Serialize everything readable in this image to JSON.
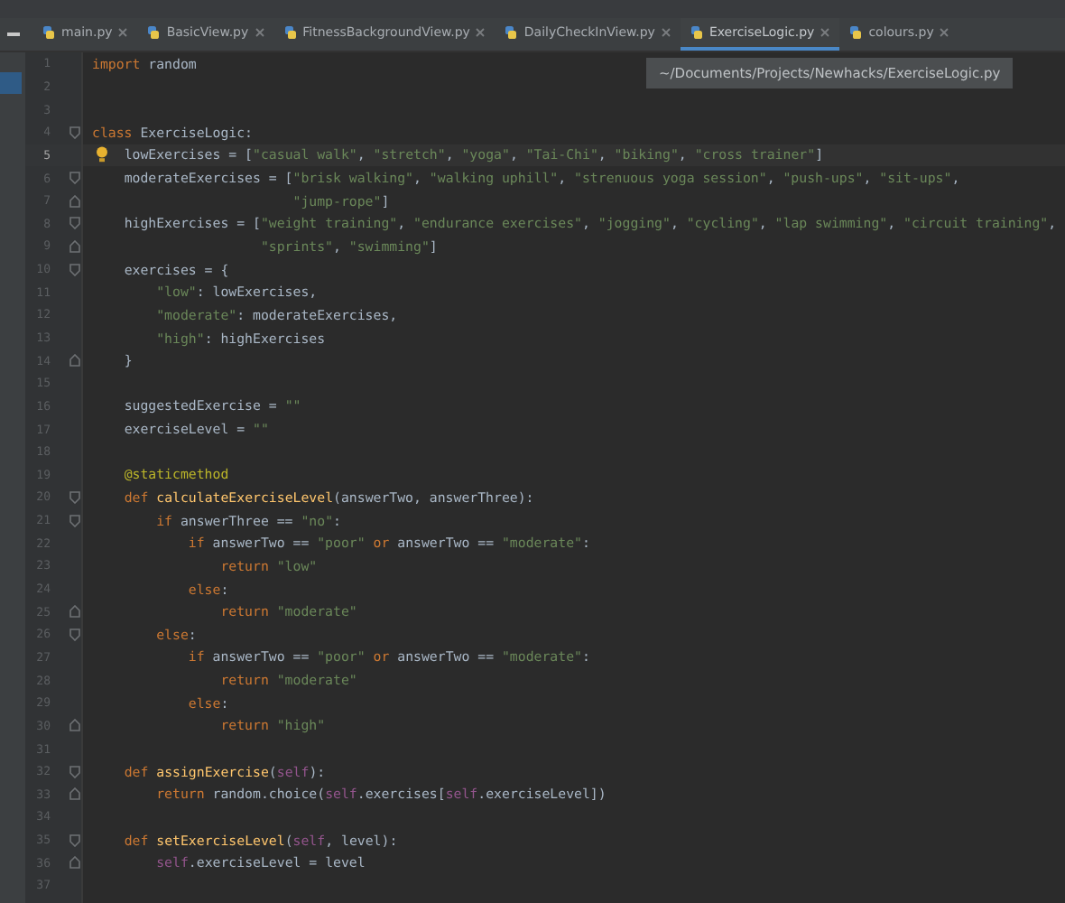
{
  "tabs": [
    {
      "label": "main.py",
      "selected": false
    },
    {
      "label": "BasicView.py",
      "selected": false
    },
    {
      "label": "FitnessBackgroundView.py",
      "selected": false
    },
    {
      "label": "DailyCheckInView.py",
      "selected": false
    },
    {
      "label": "ExerciseLogic.py",
      "selected": true
    },
    {
      "label": "colours.py",
      "selected": false
    }
  ],
  "tooltip": "~/Documents/Projects/Newhacks/ExerciseLogic.py",
  "lines": [
    {
      "number": "1",
      "current": false,
      "hint": false,
      "fold_start": false,
      "fold_end": false,
      "tokens": [
        {
          "kind": "kw",
          "text": "import"
        },
        {
          "kind": "plain",
          "text": " random"
        }
      ]
    },
    {
      "number": "2",
      "current": false,
      "hint": false,
      "fold_start": false,
      "fold_end": false
    },
    {
      "number": "3",
      "current": false,
      "hint": false,
      "fold_start": false,
      "fold_end": false
    },
    {
      "number": "4",
      "current": false,
      "hint": false,
      "fold_start": true,
      "fold_end": false,
      "tokens": [
        {
          "kind": "kw",
          "text": "class"
        },
        {
          "kind": "plain",
          "text": " ExerciseLogic:"
        }
      ]
    },
    {
      "number": "5",
      "current": true,
      "hint": true,
      "fold_start": false,
      "fold_end": false,
      "tokens": [
        {
          "kind": "plain",
          "text": "    lowExercises = ["
        },
        {
          "kind": "str",
          "text": "\"casual walk\""
        },
        {
          "kind": "plain",
          "text": ", "
        },
        {
          "kind": "str",
          "text": "\"stretch\""
        },
        {
          "kind": "plain",
          "text": ", "
        },
        {
          "kind": "str",
          "text": "\"yoga\""
        },
        {
          "kind": "plain",
          "text": ", "
        },
        {
          "kind": "str",
          "text": "\"Tai-Chi\""
        },
        {
          "kind": "plain",
          "text": ", "
        },
        {
          "kind": "str",
          "text": "\"biking\""
        },
        {
          "kind": "plain",
          "text": ", "
        },
        {
          "kind": "str",
          "text": "\"cross trainer\""
        },
        {
          "kind": "plain",
          "text": "]"
        }
      ]
    },
    {
      "number": "6",
      "current": false,
      "hint": false,
      "fold_start": true,
      "fold_end": false,
      "tokens": [
        {
          "kind": "plain",
          "text": "    moderateExercises = ["
        },
        {
          "kind": "str",
          "text": "\"brisk walking\""
        },
        {
          "kind": "plain",
          "text": ", "
        },
        {
          "kind": "str",
          "text": "\"walking uphill\""
        },
        {
          "kind": "plain",
          "text": ", "
        },
        {
          "kind": "str",
          "text": "\"strenuous yoga session\""
        },
        {
          "kind": "plain",
          "text": ", "
        },
        {
          "kind": "str",
          "text": "\"push-ups\""
        },
        {
          "kind": "plain",
          "text": ", "
        },
        {
          "kind": "str",
          "text": "\"sit-ups\""
        },
        {
          "kind": "plain",
          "text": ","
        }
      ]
    },
    {
      "number": "7",
      "current": false,
      "hint": false,
      "fold_start": false,
      "fold_end": true,
      "tokens": [
        {
          "kind": "str",
          "text": "                         \"jump-rope\""
        },
        {
          "kind": "plain",
          "text": "]"
        }
      ]
    },
    {
      "number": "8",
      "current": false,
      "hint": false,
      "fold_start": true,
      "fold_end": false,
      "tokens": [
        {
          "kind": "plain",
          "text": "    highExercises = ["
        },
        {
          "kind": "str",
          "text": "\"weight training\""
        },
        {
          "kind": "plain",
          "text": ", "
        },
        {
          "kind": "str",
          "text": "\"endurance exercises\""
        },
        {
          "kind": "plain",
          "text": ", "
        },
        {
          "kind": "str",
          "text": "\"jogging\""
        },
        {
          "kind": "plain",
          "text": ", "
        },
        {
          "kind": "str",
          "text": "\"cycling\""
        },
        {
          "kind": "plain",
          "text": ", "
        },
        {
          "kind": "str",
          "text": "\"lap swimming\""
        },
        {
          "kind": "plain",
          "text": ", "
        },
        {
          "kind": "str",
          "text": "\"circuit training\""
        },
        {
          "kind": "plain",
          "text": ","
        }
      ]
    },
    {
      "number": "9",
      "current": false,
      "hint": false,
      "fold_start": false,
      "fold_end": true,
      "tokens": [
        {
          "kind": "str",
          "text": "                     \"sprints\""
        },
        {
          "kind": "plain",
          "text": ", "
        },
        {
          "kind": "str",
          "text": "\"swimming\""
        },
        {
          "kind": "plain",
          "text": "]"
        }
      ]
    },
    {
      "number": "10",
      "current": false,
      "hint": false,
      "fold_start": true,
      "fold_end": false,
      "tokens": [
        {
          "kind": "plain",
          "text": "    exercises = {"
        }
      ]
    },
    {
      "number": "11",
      "current": false,
      "hint": false,
      "fold_start": false,
      "fold_end": false,
      "tokens": [
        {
          "kind": "str",
          "text": "        \"low\""
        },
        {
          "kind": "plain",
          "text": ": lowExercises,"
        }
      ]
    },
    {
      "number": "12",
      "current": false,
      "hint": false,
      "fold_start": false,
      "fold_end": false,
      "tokens": [
        {
          "kind": "str",
          "text": "        \"moderate\""
        },
        {
          "kind": "plain",
          "text": ": moderateExercises,"
        }
      ]
    },
    {
      "number": "13",
      "current": false,
      "hint": false,
      "fold_start": false,
      "fold_end": false,
      "tokens": [
        {
          "kind": "str",
          "text": "        \"high\""
        },
        {
          "kind": "plain",
          "text": ": highExercises"
        }
      ]
    },
    {
      "number": "14",
      "current": false,
      "hint": false,
      "fold_start": false,
      "fold_end": true,
      "tokens": [
        {
          "kind": "plain",
          "text": "    }"
        }
      ]
    },
    {
      "number": "15",
      "current": false,
      "hint": false,
      "fold_start": false,
      "fold_end": false
    },
    {
      "number": "16",
      "current": false,
      "hint": false,
      "fold_start": false,
      "fold_end": false,
      "tokens": [
        {
          "kind": "plain",
          "text": "    suggestedExercise = "
        },
        {
          "kind": "str",
          "text": "\"\""
        }
      ]
    },
    {
      "number": "17",
      "current": false,
      "hint": false,
      "fold_start": false,
      "fold_end": false,
      "tokens": [
        {
          "kind": "plain",
          "text": "    exerciseLevel = "
        },
        {
          "kind": "str",
          "text": "\"\""
        }
      ]
    },
    {
      "number": "18",
      "current": false,
      "hint": false,
      "fold_start": false,
      "fold_end": false
    },
    {
      "number": "19",
      "current": false,
      "hint": false,
      "fold_start": false,
      "fold_end": false,
      "tokens": [
        {
          "kind": "deco",
          "text": "    @staticmethod"
        }
      ]
    },
    {
      "number": "20",
      "current": false,
      "hint": false,
      "fold_start": true,
      "fold_end": false,
      "tokens": [
        {
          "kind": "kw",
          "text": "    def "
        },
        {
          "kind": "fn",
          "text": "calculateExerciseLevel"
        },
        {
          "kind": "plain",
          "text": "(answerTwo, answerThree):"
        }
      ]
    },
    {
      "number": "21",
      "current": false,
      "hint": false,
      "fold_start": true,
      "fold_end": false,
      "tokens": [
        {
          "kind": "kw",
          "text": "        if"
        },
        {
          "kind": "plain",
          "text": " answerThree == "
        },
        {
          "kind": "str",
          "text": "\"no\""
        },
        {
          "kind": "plain",
          "text": ":"
        }
      ]
    },
    {
      "number": "22",
      "current": false,
      "hint": false,
      "fold_start": false,
      "fold_end": false,
      "tokens": [
        {
          "kind": "kw",
          "text": "            if"
        },
        {
          "kind": "plain",
          "text": " answerTwo == "
        },
        {
          "kind": "str",
          "text": "\"poor\""
        },
        {
          "kind": "kw",
          "text": " or"
        },
        {
          "kind": "plain",
          "text": " answerTwo == "
        },
        {
          "kind": "str",
          "text": "\"moderate\""
        },
        {
          "kind": "plain",
          "text": ":"
        }
      ]
    },
    {
      "number": "23",
      "current": false,
      "hint": false,
      "fold_start": false,
      "fold_end": false,
      "tokens": [
        {
          "kind": "kw",
          "text": "                return "
        },
        {
          "kind": "str",
          "text": "\"low\""
        }
      ]
    },
    {
      "number": "24",
      "current": false,
      "hint": false,
      "fold_start": false,
      "fold_end": false,
      "tokens": [
        {
          "kind": "kw",
          "text": "            else"
        },
        {
          "kind": "plain",
          "text": ":"
        }
      ]
    },
    {
      "number": "25",
      "current": false,
      "hint": false,
      "fold_start": false,
      "fold_end": true,
      "tokens": [
        {
          "kind": "kw",
          "text": "                return "
        },
        {
          "kind": "str",
          "text": "\"moderate\""
        }
      ]
    },
    {
      "number": "26",
      "current": false,
      "hint": false,
      "fold_start": true,
      "fold_end": false,
      "tokens": [
        {
          "kind": "kw",
          "text": "        else"
        },
        {
          "kind": "plain",
          "text": ":"
        }
      ]
    },
    {
      "number": "27",
      "current": false,
      "hint": false,
      "fold_start": false,
      "fold_end": false,
      "tokens": [
        {
          "kind": "kw",
          "text": "            if"
        },
        {
          "kind": "plain",
          "text": " answerTwo == "
        },
        {
          "kind": "str",
          "text": "\"poor\""
        },
        {
          "kind": "kw",
          "text": " or"
        },
        {
          "kind": "plain",
          "text": " answerTwo == "
        },
        {
          "kind": "str",
          "text": "\"moderate\""
        },
        {
          "kind": "plain",
          "text": ":"
        }
      ]
    },
    {
      "number": "28",
      "current": false,
      "hint": false,
      "fold_start": false,
      "fold_end": false,
      "tokens": [
        {
          "kind": "kw",
          "text": "                return "
        },
        {
          "kind": "str",
          "text": "\"moderate\""
        }
      ]
    },
    {
      "number": "29",
      "current": false,
      "hint": false,
      "fold_start": false,
      "fold_end": false,
      "tokens": [
        {
          "kind": "kw",
          "text": "            else"
        },
        {
          "kind": "plain",
          "text": ":"
        }
      ]
    },
    {
      "number": "30",
      "current": false,
      "hint": false,
      "fold_start": false,
      "fold_end": true,
      "tokens": [
        {
          "kind": "kw",
          "text": "                return "
        },
        {
          "kind": "str",
          "text": "\"high\""
        }
      ]
    },
    {
      "number": "31",
      "current": false,
      "hint": false,
      "fold_start": false,
      "fold_end": false
    },
    {
      "number": "32",
      "current": false,
      "hint": false,
      "fold_start": true,
      "fold_end": false,
      "tokens": [
        {
          "kind": "kw",
          "text": "    def "
        },
        {
          "kind": "fn",
          "text": "assignExercise"
        },
        {
          "kind": "plain",
          "text": "("
        },
        {
          "kind": "self",
          "text": "self"
        },
        {
          "kind": "plain",
          "text": "):"
        }
      ]
    },
    {
      "number": "33",
      "current": false,
      "hint": false,
      "fold_start": false,
      "fold_end": true,
      "tokens": [
        {
          "kind": "kw",
          "text": "        return"
        },
        {
          "kind": "plain",
          "text": " random.choice("
        },
        {
          "kind": "self",
          "text": "self"
        },
        {
          "kind": "plain",
          "text": ".exercises["
        },
        {
          "kind": "self",
          "text": "self"
        },
        {
          "kind": "plain",
          "text": ".exerciseLevel])"
        }
      ]
    },
    {
      "number": "34",
      "current": false,
      "hint": false,
      "fold_start": false,
      "fold_end": false
    },
    {
      "number": "35",
      "current": false,
      "hint": false,
      "fold_start": true,
      "fold_end": false,
      "tokens": [
        {
          "kind": "kw",
          "text": "    def "
        },
        {
          "kind": "fn",
          "text": "setExerciseLevel"
        },
        {
          "kind": "plain",
          "text": "("
        },
        {
          "kind": "self",
          "text": "self"
        },
        {
          "kind": "plain",
          "text": ", level):"
        }
      ]
    },
    {
      "number": "36",
      "current": false,
      "hint": false,
      "fold_start": false,
      "fold_end": true,
      "tokens": [
        {
          "kind": "self",
          "text": "        self"
        },
        {
          "kind": "plain",
          "text": ".exerciseLevel = level"
        }
      ]
    },
    {
      "number": "37",
      "current": false,
      "hint": false,
      "fold_start": false,
      "fold_end": false
    }
  ]
}
